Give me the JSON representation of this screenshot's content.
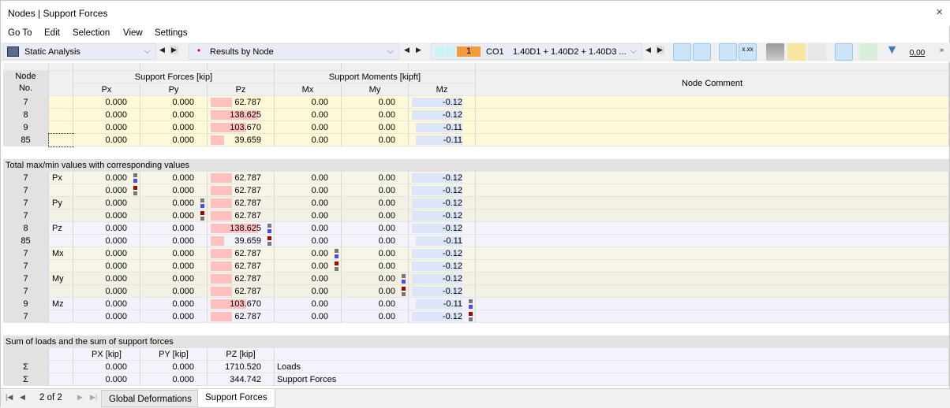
{
  "window": {
    "title": "Nodes | Support Forces",
    "close_icon": "×"
  },
  "menu": [
    "Go To",
    "Edit",
    "Selection",
    "View",
    "Settings"
  ],
  "toolbar": {
    "analysis": "Static Analysis",
    "results": "Results by Node",
    "co_number": "1",
    "co_label": "CO1",
    "combo": "1.40D1 + 1.40D2 + 1.40D3 ...",
    "more": "»",
    "decimals_icon_text": "0,00",
    "xxx_icon_text": "x.xx"
  },
  "headers": {
    "node": "Node",
    "no": "No.",
    "forces_group": "Support Forces [kip]",
    "moments_group": "Support Moments [kipft]",
    "px": "Px",
    "py": "Py",
    "pz": "Pz",
    "mx": "Mx",
    "my": "My",
    "mz": "Mz",
    "comment": "Node Comment"
  },
  "rows": [
    {
      "node": "7",
      "px": "0.000",
      "py": "0.000",
      "pz": "62.787",
      "mx": "0.00",
      "my": "0.00",
      "mz": "-0.12"
    },
    {
      "node": "8",
      "px": "0.000",
      "py": "0.000",
      "pz": "138.625",
      "mx": "0.00",
      "my": "0.00",
      "mz": "-0.12"
    },
    {
      "node": "9",
      "px": "0.000",
      "py": "0.000",
      "pz": "103.670",
      "mx": "0.00",
      "my": "0.00",
      "mz": "-0.11"
    },
    {
      "node": "85",
      "px": "0.000",
      "py": "0.000",
      "pz": "39.659",
      "mx": "0.00",
      "my": "0.00",
      "mz": "-0.11"
    }
  ],
  "maxmin": {
    "title": "Total max/min values with corresponding values",
    "rows": [
      {
        "node": "7",
        "type": "Px",
        "px": "0.000",
        "py": "0.000",
        "pz": "62.787",
        "mx": "0.00",
        "my": "0.00",
        "mz": "-0.12",
        "mark": "px",
        "kind": "max"
      },
      {
        "node": "7",
        "type": "",
        "px": "0.000",
        "py": "0.000",
        "pz": "62.787",
        "mx": "0.00",
        "my": "0.00",
        "mz": "-0.12",
        "mark": "px",
        "kind": "min"
      },
      {
        "node": "7",
        "type": "Py",
        "px": "0.000",
        "py": "0.000",
        "pz": "62.787",
        "mx": "0.00",
        "my": "0.00",
        "mz": "-0.12",
        "mark": "py",
        "kind": "max"
      },
      {
        "node": "7",
        "type": "",
        "px": "0.000",
        "py": "0.000",
        "pz": "62.787",
        "mx": "0.00",
        "my": "0.00",
        "mz": "-0.12",
        "mark": "py",
        "kind": "min"
      },
      {
        "node": "8",
        "type": "Pz",
        "px": "0.000",
        "py": "0.000",
        "pz": "138.625",
        "mx": "0.00",
        "my": "0.00",
        "mz": "-0.12",
        "mark": "pz",
        "kind": "max"
      },
      {
        "node": "85",
        "type": "",
        "px": "0.000",
        "py": "0.000",
        "pz": "39.659",
        "mx": "0.00",
        "my": "0.00",
        "mz": "-0.11",
        "mark": "pz",
        "kind": "min"
      },
      {
        "node": "7",
        "type": "Mx",
        "px": "0.000",
        "py": "0.000",
        "pz": "62.787",
        "mx": "0.00",
        "my": "0.00",
        "mz": "-0.12",
        "mark": "mx",
        "kind": "max"
      },
      {
        "node": "7",
        "type": "",
        "px": "0.000",
        "py": "0.000",
        "pz": "62.787",
        "mx": "0.00",
        "my": "0.00",
        "mz": "-0.12",
        "mark": "mx",
        "kind": "min"
      },
      {
        "node": "7",
        "type": "My",
        "px": "0.000",
        "py": "0.000",
        "pz": "62.787",
        "mx": "0.00",
        "my": "0.00",
        "mz": "-0.12",
        "mark": "my",
        "kind": "max"
      },
      {
        "node": "7",
        "type": "",
        "px": "0.000",
        "py": "0.000",
        "pz": "62.787",
        "mx": "0.00",
        "my": "0.00",
        "mz": "-0.12",
        "mark": "my",
        "kind": "min"
      },
      {
        "node": "9",
        "type": "Mz",
        "px": "0.000",
        "py": "0.000",
        "pz": "103.670",
        "mx": "0.00",
        "my": "0.00",
        "mz": "-0.11",
        "mark": "mz",
        "kind": "max"
      },
      {
        "node": "7",
        "type": "",
        "px": "0.000",
        "py": "0.000",
        "pz": "62.787",
        "mx": "0.00",
        "my": "0.00",
        "mz": "-0.12",
        "mark": "mz",
        "kind": "min"
      }
    ]
  },
  "sums": {
    "title": "Sum of loads and the sum of support forces",
    "headers": [
      "PX [kip]",
      "PY [kip]",
      "PZ [kip]"
    ],
    "rows": [
      {
        "symbol": "Σ",
        "px": "0.000",
        "py": "0.000",
        "pz": "1710.520",
        "label": "Loads"
      },
      {
        "symbol": "Σ",
        "px": "0.000",
        "py": "0.000",
        "pz": "344.742",
        "label": "Support Forces"
      }
    ]
  },
  "pager": {
    "text": "2 of 2"
  },
  "tabs": [
    {
      "label": "Global Deformations",
      "active": false
    },
    {
      "label": "Support Forces",
      "active": true
    }
  ],
  "colors": {
    "pz_bar": "#ffc0c0",
    "mz_bar": "#dce6f8",
    "max_marker": "#4a4aff",
    "min_marker": "#aa0000",
    "selected_row": "#fff9d8"
  }
}
